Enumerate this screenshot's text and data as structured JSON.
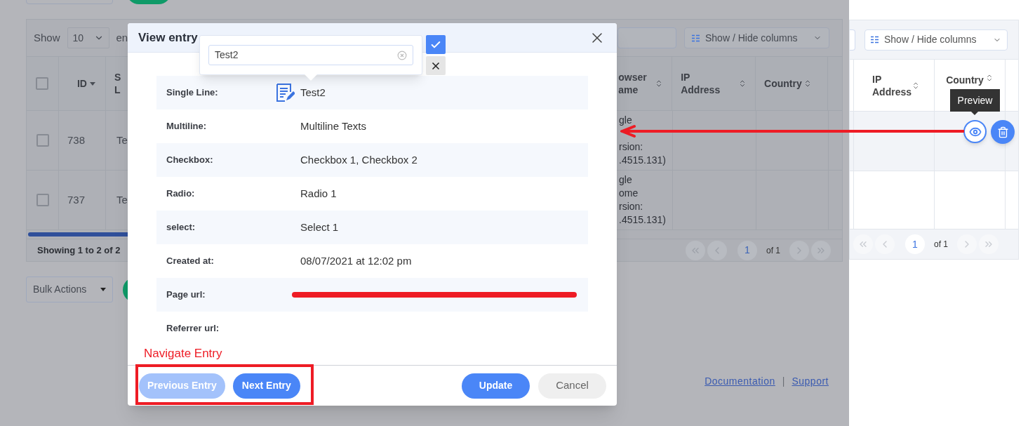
{
  "background": {
    "table": {
      "show_label": "Show",
      "page_size": "10",
      "entries_label": "en",
      "columns_button": "Show / Hide columns",
      "header_checked": false,
      "columns": [
        {
          "label": "ID",
          "sorted_desc": true
        },
        {
          "label": "S\nL",
          "sorted_desc": false,
          "sortable": false
        },
        {
          "label": "owser\name",
          "sorted_desc": false,
          "sortable": true
        },
        {
          "label": "IP\nAddress",
          "sorted_desc": false,
          "sortable": true
        },
        {
          "label": "Country",
          "sorted_desc": false,
          "sortable": true
        }
      ],
      "rows": [
        {
          "id": "738",
          "column_2": "Te",
          "browser": "gle\n\nrsion:\n.4515.131)",
          "checked": false
        },
        {
          "id": "737",
          "column_2": "Te",
          "browser": "gle\nome\nrsion:\n.4515.131)",
          "checked": false
        }
      ],
      "summary": "Showing 1 to 2 of 2",
      "pagination": {
        "current": "1",
        "total": "of 1"
      }
    },
    "bulk_actions": "Bulk Actions",
    "links": [
      {
        "label": "Documentation"
      },
      {
        "label": "Support"
      }
    ],
    "link_separator": "|"
  },
  "inset": {
    "columns_button": "Show / Hide columns",
    "columns": [
      {
        "label": "IP\nAddress",
        "sorted_desc": false,
        "sortable": true
      },
      {
        "label": "Country",
        "sorted_desc": false,
        "sortable": true
      }
    ],
    "tooltip": "Preview",
    "pagination": {
      "current": "1",
      "total": "of 1"
    }
  },
  "modal": {
    "title": "View entry",
    "fields": [
      {
        "label": "Single Line:",
        "value": "Test2",
        "editable": true,
        "redacted": false
      },
      {
        "label": "Multiline:",
        "value": "Multiline Texts",
        "editable": false,
        "redacted": false
      },
      {
        "label": "Checkbox:",
        "value": "Checkbox 1, Checkbox 2",
        "editable": false,
        "redacted": false
      },
      {
        "label": "Radio:",
        "value": "Radio 1",
        "editable": false,
        "redacted": false
      },
      {
        "label": "select:",
        "value": "Select 1",
        "editable": false,
        "redacted": false
      },
      {
        "label": "Created at:",
        "value": "08/07/2021 at 12:02 pm",
        "editable": false,
        "redacted": false
      },
      {
        "label": "Page url:",
        "editable": false,
        "redacted": true
      },
      {
        "label": "Referrer url:",
        "editable": false,
        "redacted": false
      }
    ],
    "popover": {
      "value": "Test2"
    },
    "buttons": [
      {
        "label": "Previous Entry",
        "kind": "nav",
        "disabled": true
      },
      {
        "label": "Next Entry",
        "kind": "nav",
        "disabled": false
      },
      {
        "label": "Update",
        "kind": "primary",
        "disabled": false
      },
      {
        "label": "Cancel",
        "kind": "secondary",
        "disabled": false
      }
    ]
  },
  "annotation": {
    "label": "Navigate Entry"
  }
}
